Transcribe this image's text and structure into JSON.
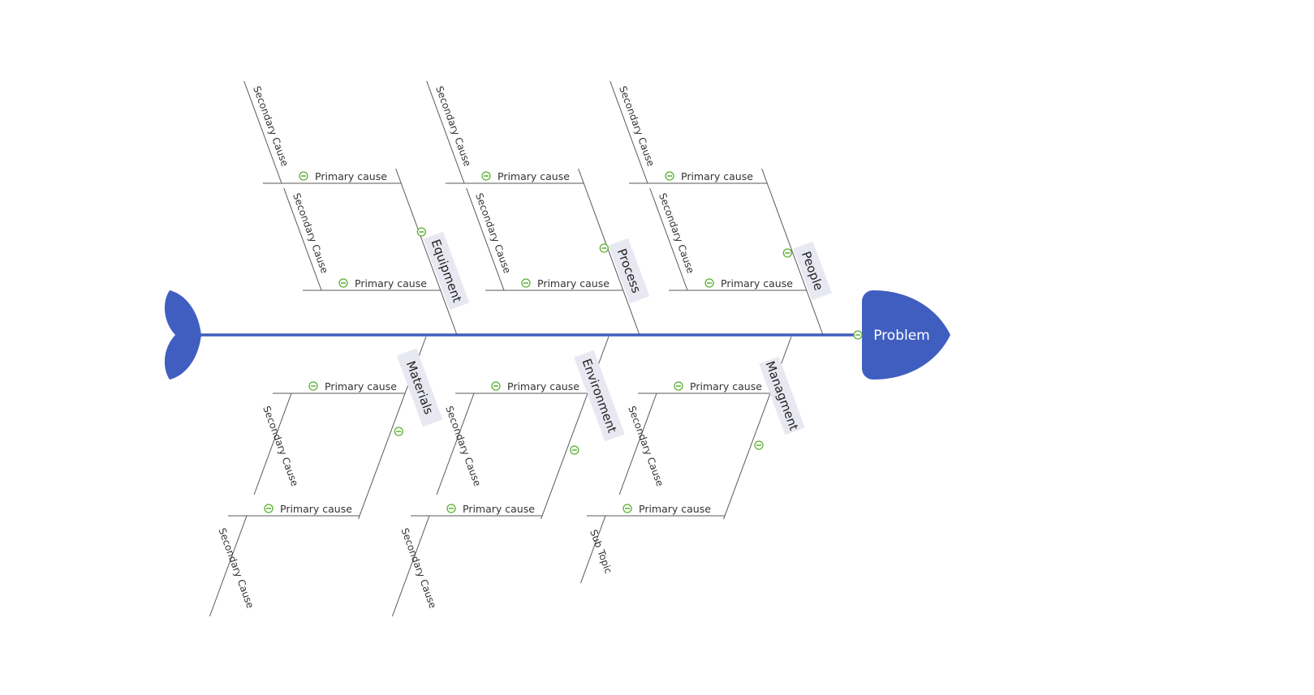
{
  "diagram": {
    "type": "fishbone",
    "problem": "Problem",
    "colors": {
      "spine": "#405EBF",
      "category_bg": "#E8E8F2",
      "collapse_icon": "#5AB030",
      "line": "#595959"
    },
    "categories": [
      {
        "label": "Equipment",
        "side": "top",
        "causes": [
          {
            "label": "Primary cause",
            "sub": "Secondary Cause"
          },
          {
            "label": "Primary cause",
            "sub": "Secondary Cause"
          }
        ]
      },
      {
        "label": "Process",
        "side": "top",
        "causes": [
          {
            "label": "Primary cause",
            "sub": "Secondary Cause"
          },
          {
            "label": "Primary cause",
            "sub": "Secondary Cause"
          }
        ]
      },
      {
        "label": "People",
        "side": "top",
        "causes": [
          {
            "label": "Primary cause",
            "sub": "Secondary Cause"
          },
          {
            "label": "Primary cause",
            "sub": "Secondary Cause"
          }
        ]
      },
      {
        "label": "Materials",
        "side": "bottom",
        "causes": [
          {
            "label": "Primary cause",
            "sub": "Secondary Cause"
          },
          {
            "label": "Primary cause",
            "sub": "Secondary Cause"
          }
        ]
      },
      {
        "label": "Environment",
        "side": "bottom",
        "causes": [
          {
            "label": "Primary cause",
            "sub": "Secondary Cause"
          },
          {
            "label": "Primary cause",
            "sub": "Secondary Cause"
          }
        ]
      },
      {
        "label": "Managment",
        "side": "bottom",
        "causes": [
          {
            "label": "Primary cause",
            "sub": "Secondary Cause"
          },
          {
            "label": "Primary cause",
            "sub": "Sub Topic"
          }
        ]
      }
    ]
  }
}
